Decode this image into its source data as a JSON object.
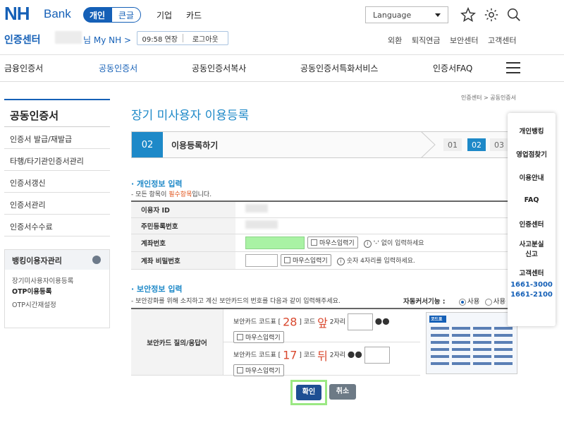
{
  "header": {
    "logo_nh": "NH",
    "logo_bank": "Bank",
    "tabs": [
      "개인",
      "큰글"
    ],
    "menu": [
      "기업",
      "카드"
    ],
    "language": "Language",
    "cert_title": "인증센터",
    "user_suffix": "님 My NH >",
    "timer": "09:58 연장",
    "logout": "로그아웃",
    "util_links": [
      "외환",
      "퇴직연금",
      "보안센터",
      "고객센터"
    ]
  },
  "gnb": {
    "items": [
      "금융인증서",
      "공동인증서",
      "공동인증서복사",
      "공동인증서특화서비스",
      "인증서FAQ"
    ]
  },
  "lnb": {
    "title": "공동인증서",
    "items": [
      "인증서 발급/재발급",
      "타행/타기관인증서관리",
      "인증서갱신",
      "인증서관리",
      "인증서수수료"
    ],
    "box_title": "뱅킹이용자관리",
    "sub_items": [
      "장기미사용자이용등록",
      "OTP이용등록",
      "OTP시간재설정"
    ]
  },
  "main": {
    "breadcrumb": "인증센터 > 공동인증서",
    "title": "장기 미사용자 이용등록",
    "step_current_num": "02",
    "step_current_label": "이용등록하기",
    "steps_mini": [
      "01",
      "02",
      "03"
    ],
    "personal": {
      "title": "· 개인정보 입력",
      "desc_pre": "- 모든 항목이 ",
      "desc_req": "필수항목",
      "desc_post": "입니다.",
      "rows": {
        "user_id": "이용자 ID",
        "resident_no": "주민등록번호",
        "account_no": "계좌번호",
        "account_pw": "계좌 비밀번호"
      },
      "mouse_input": "마우스입력기",
      "hint_account": "'-' 없이 입력하세요",
      "hint_pw": "숫자 4자리를 입력하세요."
    },
    "security": {
      "title": "· 보안정보 입력",
      "desc": "- 보안강화를 위해 소지하고 계신 보안카드의 번호를 다음과 같이 입력해주세요.",
      "auto_cursor": "자동커서기능 :",
      "radio_use": "사용",
      "radio_nouse": "사용",
      "th": "보안카드 질의/응답어",
      "q1_pre": "보안카드 코드표 [",
      "q1_num": "28",
      "q1_mid": "] 코드",
      "q1_pos": "앞",
      "q1_post": "2자리",
      "q2_pre": "보안카드 코드표 [",
      "q2_num": "17",
      "q2_mid": "] 코드",
      "q2_pos": "뒤",
      "q2_post": "2자리",
      "dots": "●●",
      "card_title": "코드표"
    },
    "confirm": "확인",
    "cancel": "취소"
  },
  "quick": {
    "items": [
      "개인뱅킹",
      "영업점찾기",
      "이용안내",
      "FAQ",
      "인증센터",
      "사고분실 신고"
    ],
    "cs_title": "고객센터",
    "phones": [
      "1661-3000",
      "1661-2100"
    ]
  },
  "colors": {
    "brand": "#1560b7",
    "accent": "#1e89c8",
    "confirm": "#1e4f93"
  }
}
